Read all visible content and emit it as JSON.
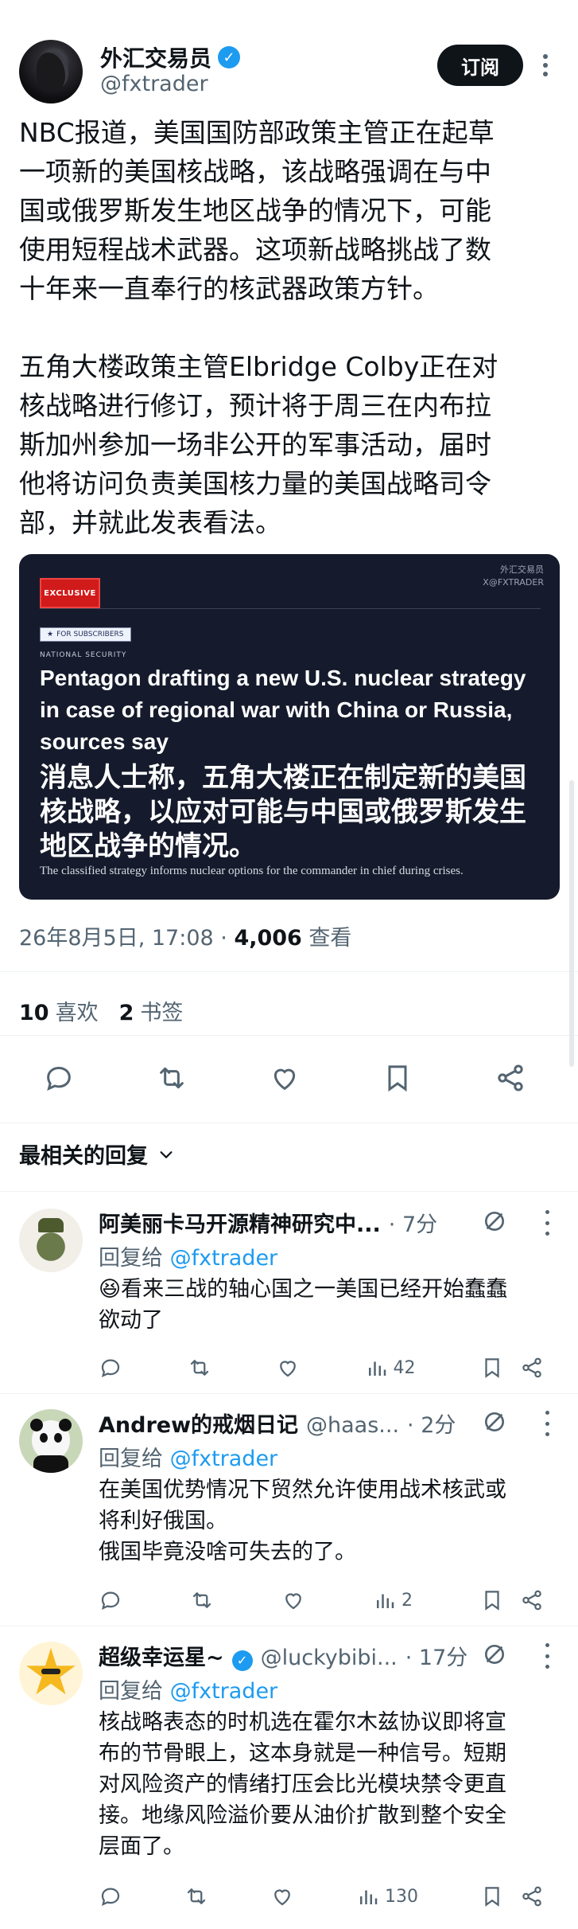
{
  "post": {
    "author_name": "外汇交易员",
    "author_handle": "@fxtrader",
    "subscribe_label": "订阅",
    "text": "NBC报道，美国国防部政策主管正在起草\n一项新的美国核战略，该战略强调在与中\n国或俄罗斯发生地区战争的情况下，可能\n使用短程战术武器。这项新战略挑战了数\n十年来一直奉行的核武器政策方针。\n\n五角大楼政策主管Elbridge Colby正在对\n核战略进行修订，预计将于周三在内布拉\n斯加州参加一场非公开的军事活动，届时\n他将访问负责美国核力量的美国战略司令\n部，并就此发表看法。",
    "image": {
      "watermark_line1": "外汇交易员",
      "watermark_line2": "X@FXTRADER",
      "badge": "EXCLUSIVE",
      "subscribers_tag": "FOR SUBSCRIBERS",
      "section": "NATIONAL SECURITY",
      "headline_en": "Pentagon drafting a new U.S. nuclear strategy in case of regional war with China or Russia, sources say",
      "headline_cn": "消息人士称，五角大楼正在制定新的美国核战略，以应对可能与中国或俄罗斯发生地区战争的情况。",
      "caption": "The classified strategy informs nuclear options for the commander in chief during crises."
    },
    "timestamp": "26年8月5日, 17:08 · ",
    "views_count": "4,006",
    "views_label": " 查看",
    "likes_count": "10",
    "likes_label": "喜欢",
    "bookmarks_count": "2",
    "bookmarks_label": "书签"
  },
  "sort_label": "最相关的回复",
  "replies": [
    {
      "name": "阿美丽卡马开源精神研究中...",
      "handle": "",
      "time": "· 7分",
      "reply_prefix": "回复给 ",
      "reply_to": "@fxtrader",
      "text": "😆看来三战的轴心国之一美国已经开始蠢蠢\n欲动了",
      "views": "42"
    },
    {
      "name": "Andrew的戒烟日记",
      "handle": "@haas...",
      "time": "· 2分",
      "reply_prefix": "回复给 ",
      "reply_to": "@fxtrader",
      "text": "在美国优势情况下贸然允许使用战术核武或\n将利好俄国。\n俄国毕竟没啥可失去的了。",
      "views": "2"
    },
    {
      "name": "超级幸运星~",
      "handle": "@luckybibi...",
      "time": "· 17分",
      "reply_prefix": "回复给 ",
      "reply_to": "@fxtrader",
      "text": "核战略表态的时机选在霍尔木兹协议即将宣\n布的节骨眼上，这本身就是一种信号。短期\n对风险资产的情绪打压会比光模块禁令更直\n接。地缘风险溢价要从油价扩散到整个安全\n层面了。",
      "views": "130"
    }
  ],
  "colors": {
    "text": "#0f1419",
    "secondary": "#536471",
    "accent": "#1d9bf0",
    "media_bg": "#151b2c",
    "exclusive_red": "#d11a1a"
  }
}
